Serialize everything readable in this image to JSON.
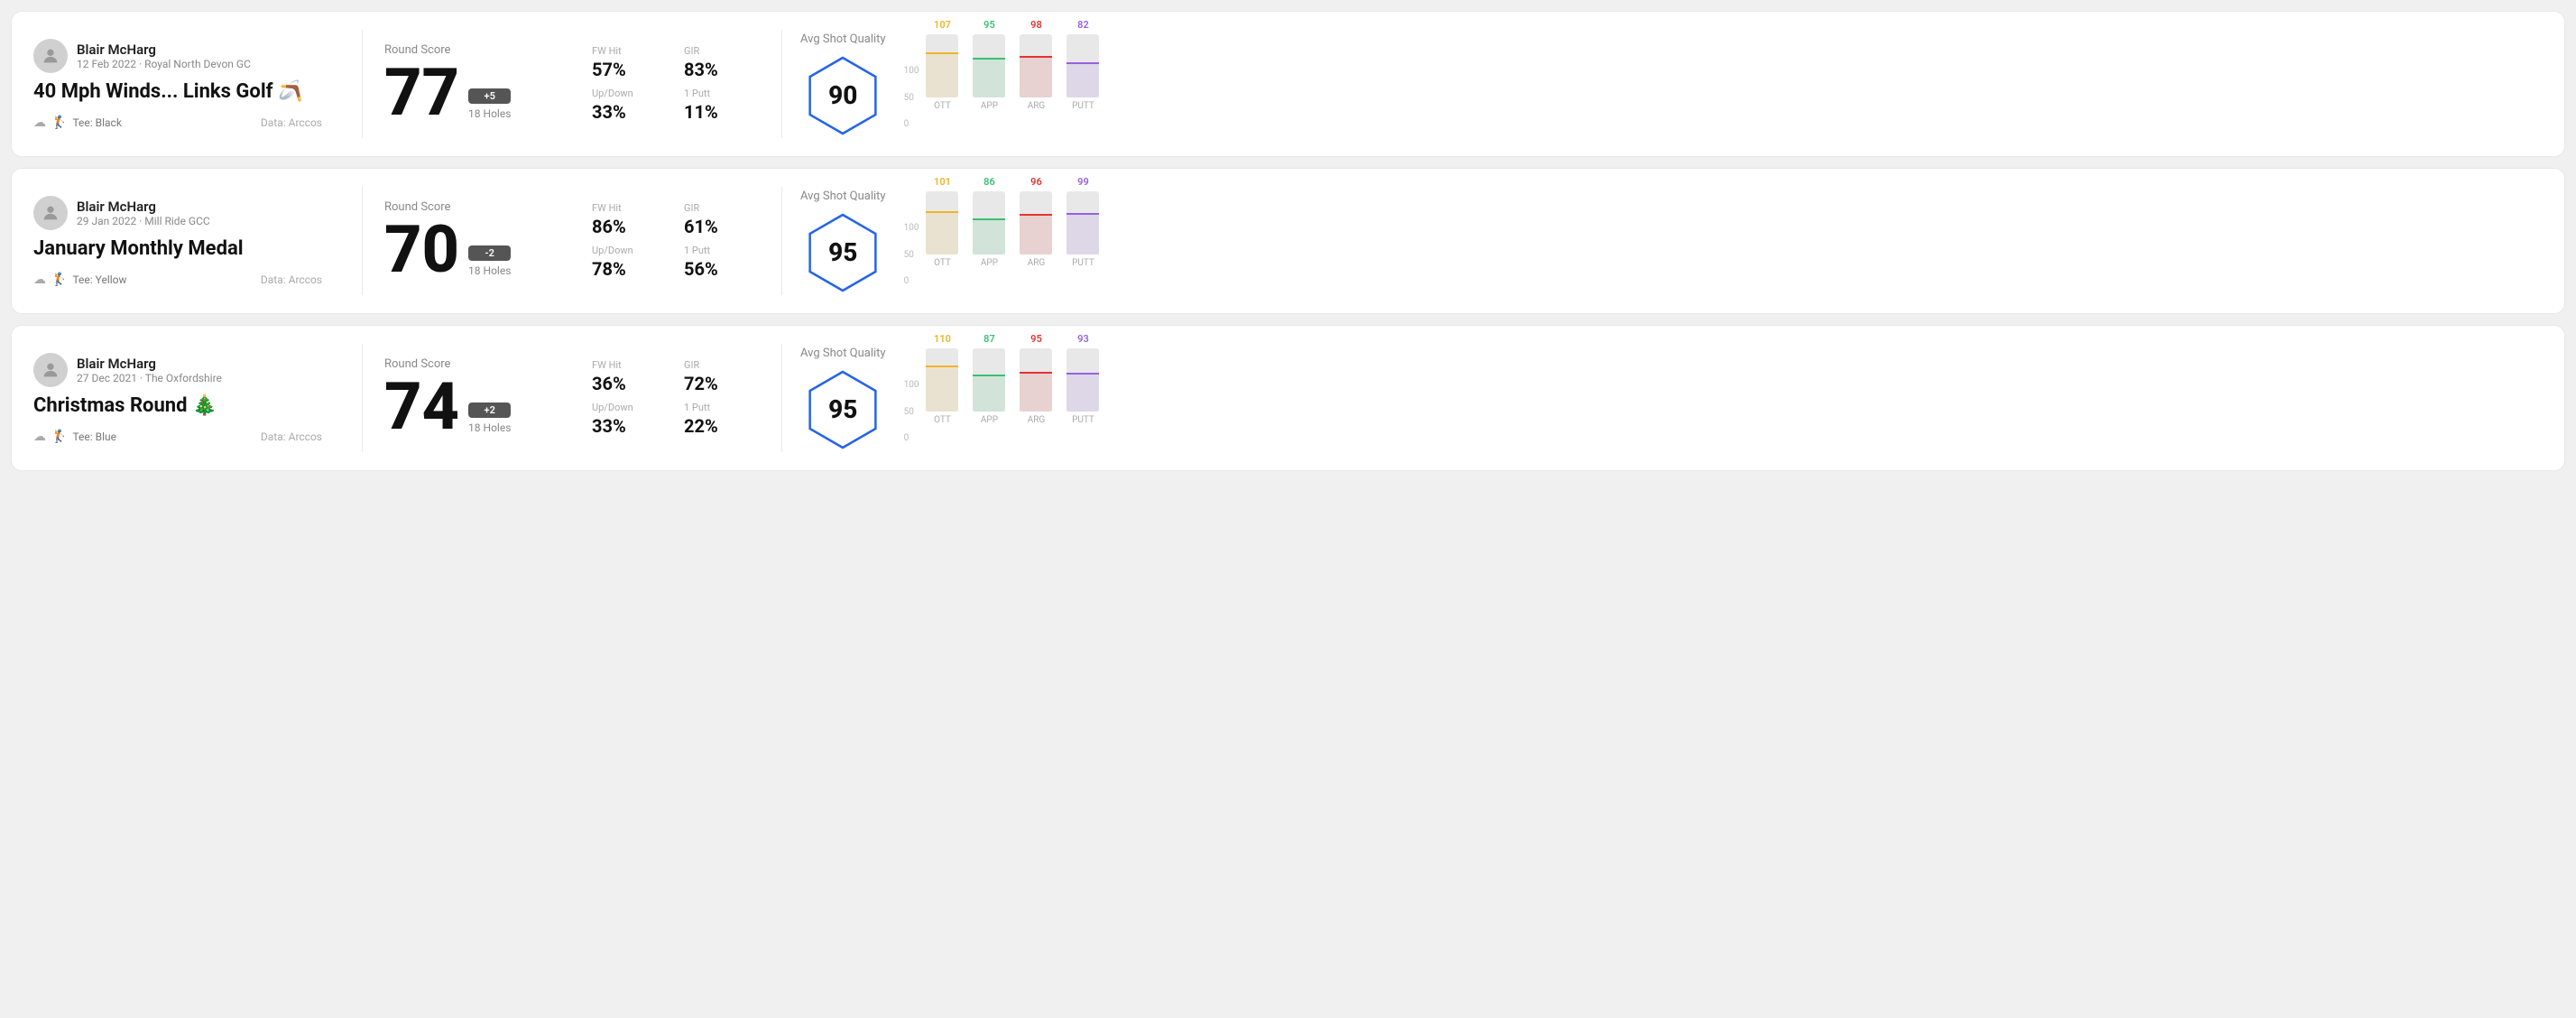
{
  "rounds": [
    {
      "id": "round1",
      "user_name": "Blair McHarg",
      "date_course": "12 Feb 2022 · Royal North Devon GC",
      "title": "40 Mph Winds... Links Golf 🪃",
      "tee": "Tee: Black",
      "data_source": "Data: Arccos",
      "round_score_label": "Round Score",
      "score": "77",
      "score_diff": "+5",
      "holes": "18 Holes",
      "fw_hit_label": "FW Hit",
      "fw_hit_value": "57%",
      "gir_label": "GIR",
      "gir_value": "83%",
      "updown_label": "Up/Down",
      "updown_value": "33%",
      "oneputt_label": "1 Putt",
      "oneputt_value": "11%",
      "avg_shot_quality_label": "Avg Shot Quality",
      "quality_score": "90",
      "chart": {
        "bars": [
          {
            "label_bottom": "OTT",
            "value": 107,
            "color": "#f0b429",
            "percent": 72
          },
          {
            "label_bottom": "APP",
            "value": 95,
            "color": "#38c172",
            "percent": 63
          },
          {
            "label_bottom": "ARG",
            "value": 98,
            "color": "#e3342f",
            "percent": 65
          },
          {
            "label_bottom": "PUTT",
            "value": 82,
            "color": "#9561e2",
            "percent": 55
          }
        ]
      }
    },
    {
      "id": "round2",
      "user_name": "Blair McHarg",
      "date_course": "29 Jan 2022 · Mill Ride GCC",
      "title": "January Monthly Medal",
      "tee": "Tee: Yellow",
      "data_source": "Data: Arccos",
      "round_score_label": "Round Score",
      "score": "70",
      "score_diff": "-2",
      "holes": "18 Holes",
      "fw_hit_label": "FW Hit",
      "fw_hit_value": "86%",
      "gir_label": "GIR",
      "gir_value": "61%",
      "updown_label": "Up/Down",
      "updown_value": "78%",
      "oneputt_label": "1 Putt",
      "oneputt_value": "56%",
      "avg_shot_quality_label": "Avg Shot Quality",
      "quality_score": "95",
      "chart": {
        "bars": [
          {
            "label_bottom": "OTT",
            "value": 101,
            "color": "#f0b429",
            "percent": 68
          },
          {
            "label_bottom": "APP",
            "value": 86,
            "color": "#38c172",
            "percent": 57
          },
          {
            "label_bottom": "ARG",
            "value": 96,
            "color": "#e3342f",
            "percent": 64
          },
          {
            "label_bottom": "PUTT",
            "value": 99,
            "color": "#9561e2",
            "percent": 66
          }
        ]
      }
    },
    {
      "id": "round3",
      "user_name": "Blair McHarg",
      "date_course": "27 Dec 2021 · The Oxfordshire",
      "title": "Christmas Round 🎄",
      "tee": "Tee: Blue",
      "data_source": "Data: Arccos",
      "round_score_label": "Round Score",
      "score": "74",
      "score_diff": "+2",
      "holes": "18 Holes",
      "fw_hit_label": "FW Hit",
      "fw_hit_value": "36%",
      "gir_label": "GIR",
      "gir_value": "72%",
      "updown_label": "Up/Down",
      "updown_value": "33%",
      "oneputt_label": "1 Putt",
      "oneputt_value": "22%",
      "avg_shot_quality_label": "Avg Shot Quality",
      "quality_score": "95",
      "chart": {
        "bars": [
          {
            "label_bottom": "OTT",
            "value": 110,
            "color": "#f0b429",
            "percent": 73
          },
          {
            "label_bottom": "APP",
            "value": 87,
            "color": "#38c172",
            "percent": 58
          },
          {
            "label_bottom": "ARG",
            "value": 95,
            "color": "#e3342f",
            "percent": 63
          },
          {
            "label_bottom": "PUTT",
            "value": 93,
            "color": "#9561e2",
            "percent": 62
          }
        ]
      }
    }
  ],
  "y_axis_labels": [
    "100",
    "50",
    "0"
  ]
}
